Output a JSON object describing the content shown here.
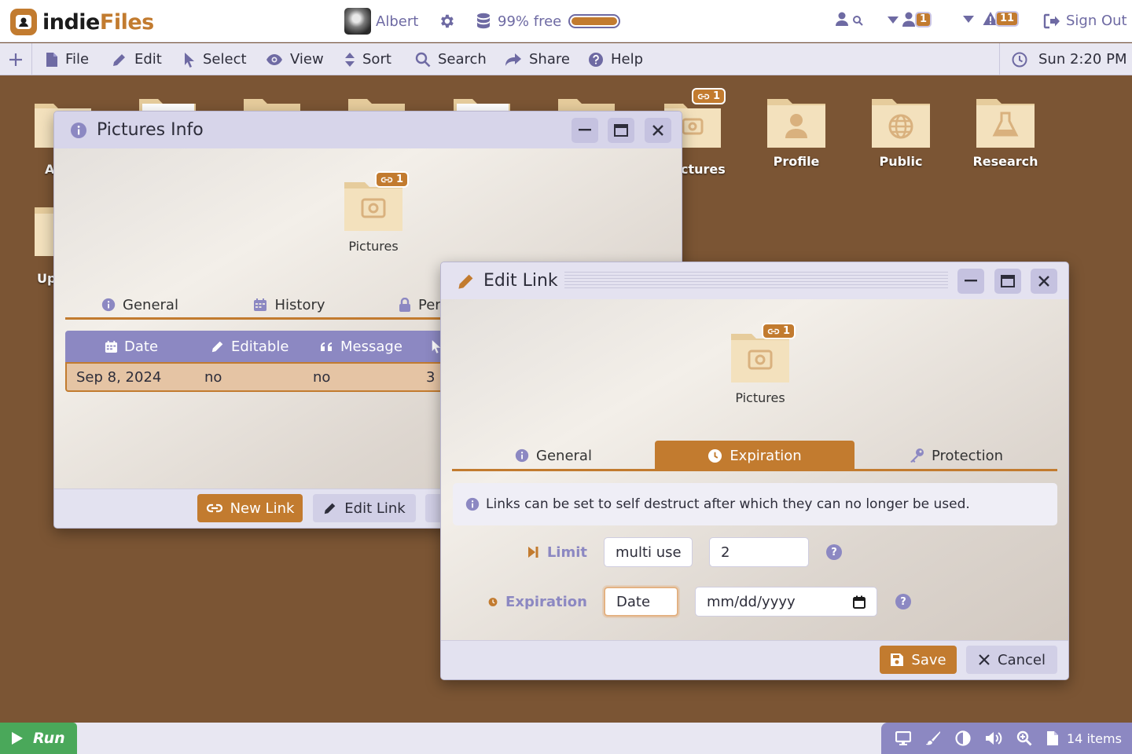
{
  "app": {
    "logo_part1": "indie",
    "logo_part2": "Files"
  },
  "header": {
    "username": "Albert",
    "storage_text": "99% free",
    "storage_used_fraction": 0.99,
    "notifications_count": "1",
    "alerts_count": "11",
    "sign_out": "Sign Out"
  },
  "menu": {
    "file": "File",
    "edit": "Edit",
    "select": "Select",
    "view": "View",
    "sort": "Sort",
    "search": "Search",
    "share": "Share",
    "help": "Help",
    "clock": "Sun 2:20 PM"
  },
  "desktop": {
    "partial_a": "A",
    "partial_up": "Up",
    "pictures_partial": "ctures",
    "pictures_link_count": "1",
    "profile": "Profile",
    "public": "Public",
    "research": "Research"
  },
  "pictures_info": {
    "title": "Pictures Info",
    "folder_name": "Pictures",
    "link_count": "1",
    "tabs": [
      "General",
      "History",
      "Per"
    ],
    "columns": [
      "Date",
      "Editable",
      "Message"
    ],
    "rows": [
      {
        "date": "Sep 8, 2024",
        "editable": "no",
        "message": "no",
        "uses": "3"
      }
    ],
    "buttons": {
      "new_link": "New Link",
      "edit_link": "Edit Link"
    }
  },
  "edit_link": {
    "title": "Edit Link",
    "folder_name": "Pictures",
    "link_count": "1",
    "tabs": [
      "General",
      "Expiration",
      "Protection"
    ],
    "active_tab": "Expiration",
    "info_text": "Links can be set to self destruct after which they can no longer be used.",
    "limit_label": "Limit",
    "limit_mode": "multi use",
    "limit_value": "2",
    "expiration_label": "Expiration",
    "expiration_mode": "Date",
    "expiration_date_placeholder": "mm/dd/yyyy",
    "help_symbol": "?",
    "save": "Save",
    "cancel": "Cancel"
  },
  "taskbar": {
    "run": "Run",
    "item_count": "14 items"
  },
  "colors": {
    "accent": "#c27b2f",
    "purple": "#8c88c2",
    "desktop": "#7b5534"
  }
}
